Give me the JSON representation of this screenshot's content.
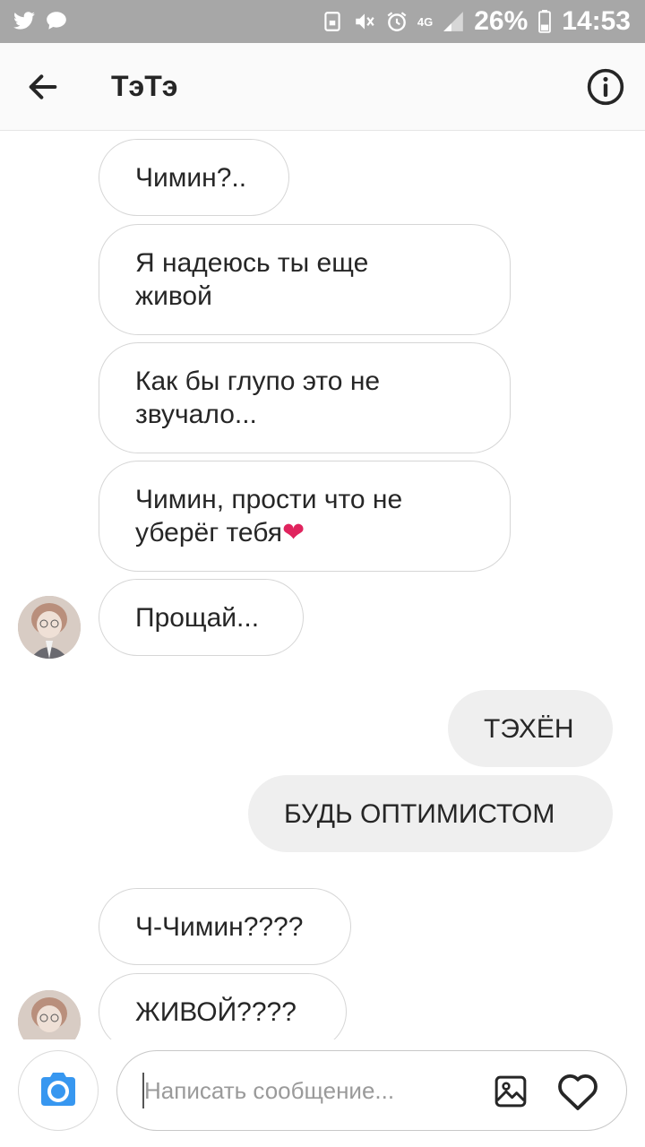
{
  "status_bar": {
    "battery_percent": "26%",
    "time": "14:53",
    "network": "4G",
    "icons": [
      "twitter-icon",
      "chat-bubble-icon",
      "lock-icon",
      "mute-icon",
      "alarm-icon",
      "network-icon",
      "signal-icon",
      "battery-icon"
    ]
  },
  "header": {
    "title": "ТэТэ",
    "back_icon": "arrow-left-icon",
    "info_icon": "info-icon"
  },
  "messages": [
    {
      "direction": "in",
      "text": "Чимин?..",
      "avatar": false
    },
    {
      "direction": "in",
      "text": "Я надеюсь ты еще\nживой",
      "avatar": false
    },
    {
      "direction": "in",
      "text": "Как бы глупо это не\nзвучало...",
      "avatar": false
    },
    {
      "direction": "in",
      "text": "Чимин, прости что не\nуберёг тебя",
      "emoji": "❤",
      "avatar": false
    },
    {
      "direction": "in",
      "text": "Прощай...",
      "avatar": true
    },
    {
      "direction": "out",
      "text": "ТЭХЁН"
    },
    {
      "direction": "out",
      "text": "БУДЬ ОПТИМИСТОМ"
    },
    {
      "direction": "in",
      "text": "Ч-Чимин????",
      "avatar": false
    },
    {
      "direction": "in",
      "text": "ЖИВОЙ????",
      "avatar": true
    }
  ],
  "composer": {
    "placeholder": "Написать сообщение...",
    "value": "",
    "camera_icon": "camera-icon",
    "gallery_icon": "image-icon",
    "like_icon": "heart-icon"
  },
  "colors": {
    "status_bar_bg": "#a7a7a7",
    "header_bg": "#fafafa",
    "incoming_border": "#d6d6d6",
    "outgoing_bg": "#efefef",
    "camera_blue": "#3797f0",
    "text": "#262626",
    "heart_red": "#e0245e"
  }
}
